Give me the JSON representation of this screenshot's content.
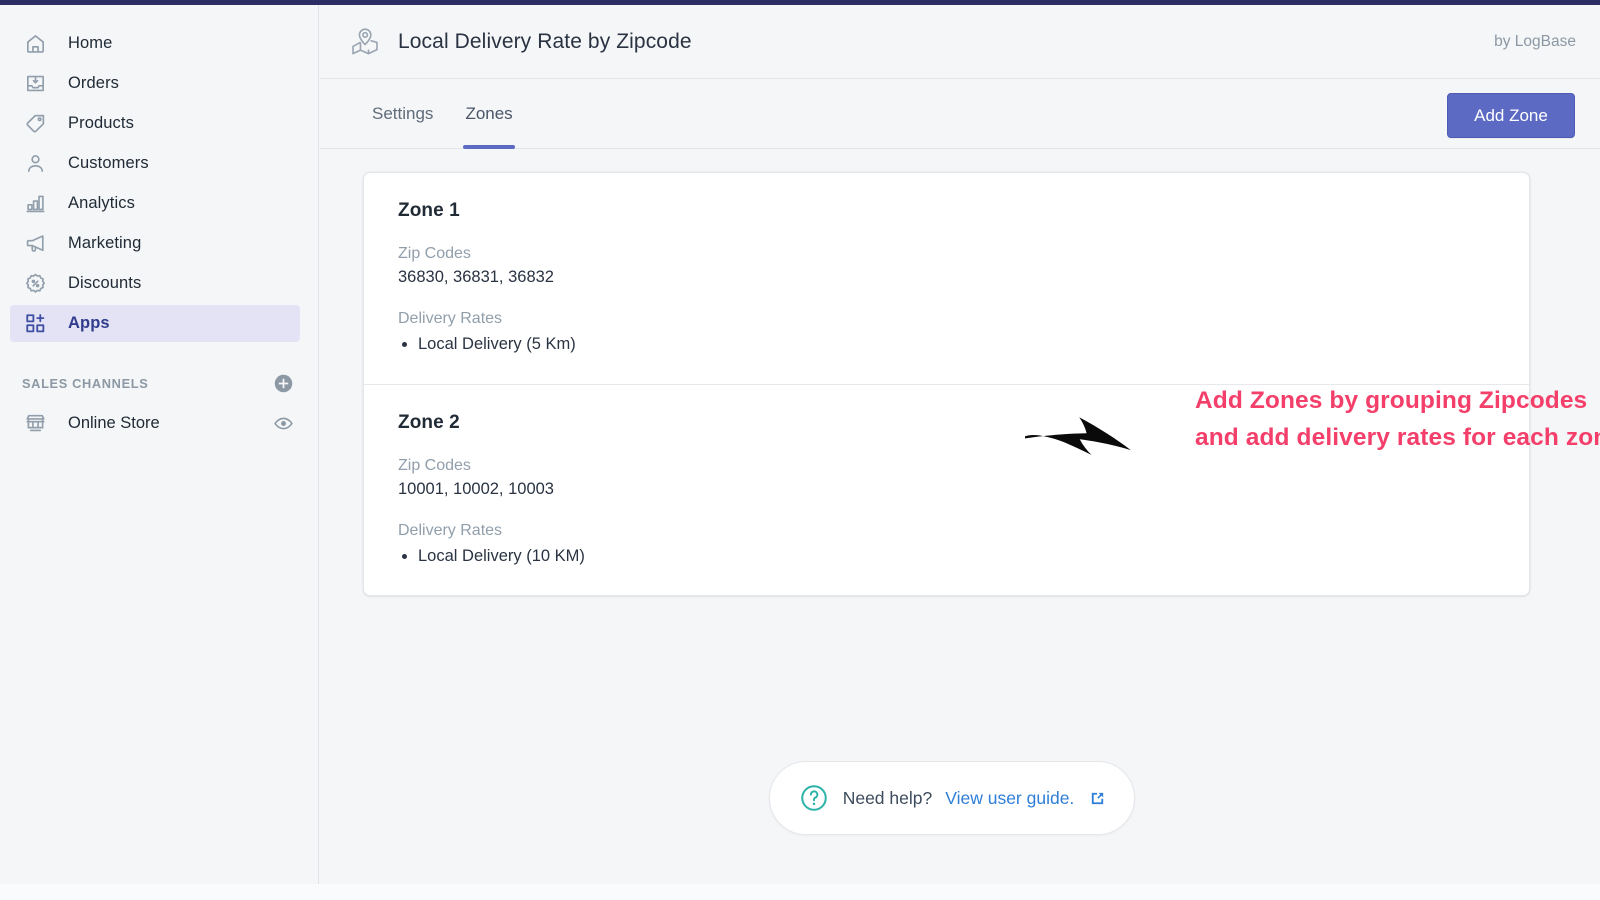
{
  "colors": {
    "topbar": "#2b2d64",
    "accent_indigo": "#5c6ac4",
    "annotation_pink": "#f43f6b",
    "link_blue": "#2f7ed8",
    "help_teal": "#2bb3a8",
    "muted_text": "#919eab",
    "body_text": "#212b36",
    "active_nav_bg": "#e3e3f5",
    "canvas_bg": "#f4f6f8"
  },
  "sidebar": {
    "items": [
      {
        "label": "Home",
        "icon": "home-icon",
        "active": false
      },
      {
        "label": "Orders",
        "icon": "orders-inbox-icon",
        "active": false
      },
      {
        "label": "Products",
        "icon": "product-tag-icon",
        "active": false
      },
      {
        "label": "Customers",
        "icon": "customer-person-icon",
        "active": false
      },
      {
        "label": "Analytics",
        "icon": "analytics-bar-chart-icon",
        "active": false
      },
      {
        "label": "Marketing",
        "icon": "marketing-megaphone-icon",
        "active": false
      },
      {
        "label": "Discounts",
        "icon": "discount-percent-badge-icon",
        "active": false
      },
      {
        "label": "Apps",
        "icon": "apps-grid-plus-icon",
        "active": true
      }
    ],
    "section": {
      "title": "SALES CHANNELS",
      "add_icon": "plus-circle-icon"
    },
    "channels": [
      {
        "label": "Online Store",
        "icon": "online-store-icon",
        "action_icon": "eye-icon"
      }
    ]
  },
  "header": {
    "app_icon": "map-pin-location-icon",
    "title": "Local Delivery Rate by Zipcode",
    "byline": "by LogBase"
  },
  "tabs": {
    "items": [
      {
        "label": "Settings",
        "active": false
      },
      {
        "label": "Zones",
        "active": true
      }
    ],
    "add_zone_label": "Add Zone"
  },
  "zones": {
    "zip_label": "Zip Codes",
    "rates_label": "Delivery Rates",
    "list": [
      {
        "name": "Zone 1",
        "zip_codes": "36830, 36831, 36832",
        "rates": [
          "Local Delivery (5 Km)"
        ]
      },
      {
        "name": "Zone 2",
        "zip_codes": "10001, 10002, 10003",
        "rates": [
          "Local Delivery (10 KM)"
        ]
      }
    ]
  },
  "annotation": {
    "arrow_icon": "right-arrow-annotation-icon",
    "text": "Add Zones by grouping Zipcodes and add delivery rates for each zone"
  },
  "help": {
    "icon": "question-mark-circle-icon",
    "text": "Need help?",
    "link_label": "View user guide.",
    "external_icon": "external-link-icon"
  }
}
